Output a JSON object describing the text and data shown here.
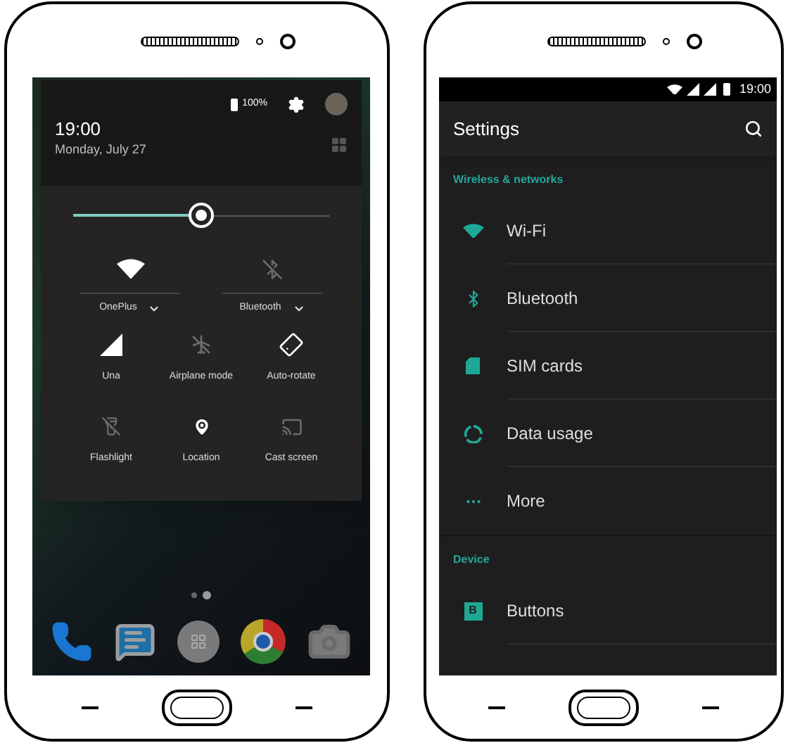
{
  "quick_settings": {
    "battery": "100%",
    "time": "19:00",
    "date": "Monday, July 27",
    "brightness": {
      "level": 0.5
    },
    "big_tiles": [
      {
        "kind": "wifi",
        "label": "OnePlus",
        "on": true
      },
      {
        "kind": "bluetooth",
        "label": "Bluetooth",
        "on": false
      }
    ],
    "tiles": [
      {
        "kind": "signal",
        "label": "Una",
        "on": true
      },
      {
        "kind": "airplane",
        "label": "Airplane mode",
        "on": false
      },
      {
        "kind": "rotate",
        "label": "Auto-rotate",
        "on": true
      },
      {
        "kind": "flashlight",
        "label": "Flashlight",
        "on": false
      },
      {
        "kind": "location",
        "label": "Location",
        "on": true
      },
      {
        "kind": "cast",
        "label": "Cast screen",
        "on": false
      }
    ]
  },
  "home_screen": {
    "pages": [
      {
        "selected": false
      },
      {
        "selected": true
      }
    ]
  },
  "settings": {
    "status_bar": {
      "time": "19:00"
    },
    "title": "Settings",
    "sections": [
      {
        "header": "Wireless & networks",
        "items": [
          {
            "kind": "wifi",
            "label": "Wi-Fi"
          },
          {
            "kind": "bluetooth",
            "label": "Bluetooth"
          },
          {
            "kind": "sim",
            "label": "SIM cards"
          },
          {
            "kind": "data",
            "label": "Data usage"
          },
          {
            "kind": "more",
            "label": "More"
          }
        ]
      },
      {
        "header": "Device",
        "items": [
          {
            "kind": "buttons",
            "label": "Buttons",
            "badge": "B"
          }
        ]
      }
    ]
  }
}
